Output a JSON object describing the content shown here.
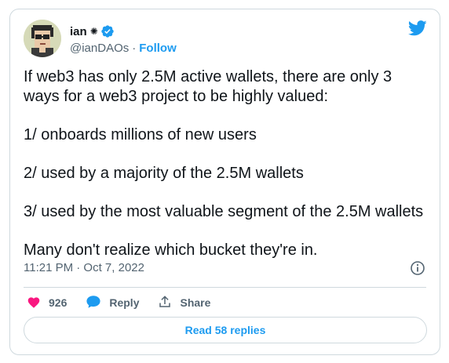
{
  "author": {
    "name": "ian",
    "name_glyph": "✺",
    "handle": "@ianDAOs",
    "separator": "·",
    "follow_label": "Follow"
  },
  "tweet": {
    "lines": [
      "If web3 has only 2.5M active wallets, there are only 3 ways for a web3 project to be highly valued:",
      "1/ onboards millions of new users",
      "2/ used by a majority of the 2.5M wallets",
      "3/ used by the most valuable segment of the 2.5M wallets",
      "Many don't realize which bucket they're in."
    ],
    "timestamp": "11:21 PM · Oct 7, 2022"
  },
  "actions": {
    "likes_count": "926",
    "reply_label": "Reply",
    "share_label": "Share"
  },
  "read_replies_label": "Read 58 replies",
  "icons": {
    "brand": "twitter-bird-icon",
    "verified": "verified-badge-icon",
    "info": "info-icon",
    "like": "heart-icon",
    "reply": "reply-bubble-icon",
    "share": "share-icon"
  },
  "colors": {
    "accent": "#1d9bf0",
    "like": "#f91880",
    "text": "#0f1419",
    "muted": "#536471",
    "border": "#cfd9de"
  }
}
